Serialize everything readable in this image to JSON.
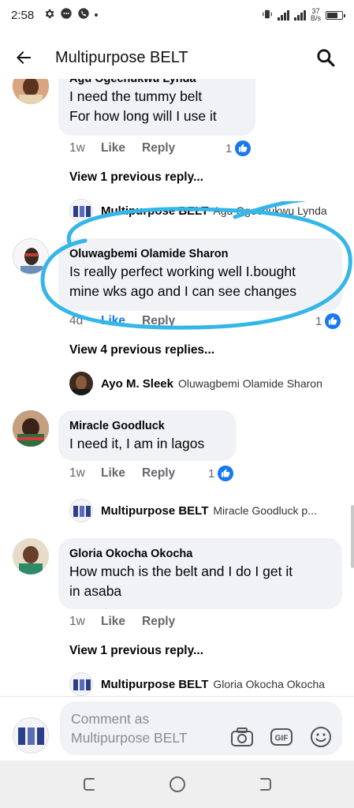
{
  "status_bar": {
    "time": "2:58",
    "network_speed": "37",
    "network_unit": "B/s",
    "icons": [
      "gear-icon",
      "messenger-icon",
      "phone-icon",
      "signal-icon",
      "battery-icon"
    ]
  },
  "header": {
    "title": "Multipurpose BELT",
    "back_icon": "arrow-left-icon",
    "search_icon": "search-icon"
  },
  "comments": [
    {
      "author": "Agu Ogechukwu Lynda",
      "lines": [
        "I need the tummy belt",
        "For how long will I use it"
      ],
      "time": "1w",
      "like_label": "Like",
      "reply_label": "Reply",
      "reaction_count": "1",
      "view_replies": "View 1 previous reply...",
      "reply": {
        "author": "Multipurpose BELT",
        "preview": "Agu Ogechukwu Lynda"
      }
    },
    {
      "author": "Oluwagbemi Olamide Sharon",
      "lines": [
        "Is really perfect working well I.bought",
        "mine wks ago and I can see changes"
      ],
      "time": "4d",
      "like_label": "Like",
      "reply_label": "Reply",
      "reaction_count": "1",
      "view_replies": "View 4 previous replies...",
      "reply": {
        "author": "Ayo M. Sleek",
        "preview": "Oluwagbemi Olamide Sharon"
      }
    },
    {
      "author": "Miracle Goodluck",
      "lines": [
        "I need it, I am in lagos"
      ],
      "time": "1w",
      "like_label": "Like",
      "reply_label": "Reply",
      "reaction_count": "1",
      "reply": {
        "author": "Multipurpose BELT",
        "preview": "Miracle Goodluck p..."
      }
    },
    {
      "author": "Gloria Okocha Okocha",
      "lines": [
        "How much is the belt and I do I get it",
        "in asaba"
      ],
      "time": "1w",
      "like_label": "Like",
      "reply_label": "Reply",
      "view_replies": "View 1 previous reply...",
      "reply": {
        "author": "Multipurpose BELT",
        "preview": "Gloria Okocha Okocha"
      }
    }
  ],
  "composer": {
    "placeholder": "Comment as Multipurpose BELT",
    "icons": [
      "camera-icon",
      "gif-icon",
      "emoji-icon"
    ]
  },
  "navbar": {
    "icons": [
      "recents-icon",
      "home-icon",
      "back-icon"
    ]
  },
  "colors": {
    "bubble": "#f0f2f5",
    "like_blue": "#1877f2",
    "annotation": "#35b6e8",
    "meta_text": "#65676b"
  }
}
